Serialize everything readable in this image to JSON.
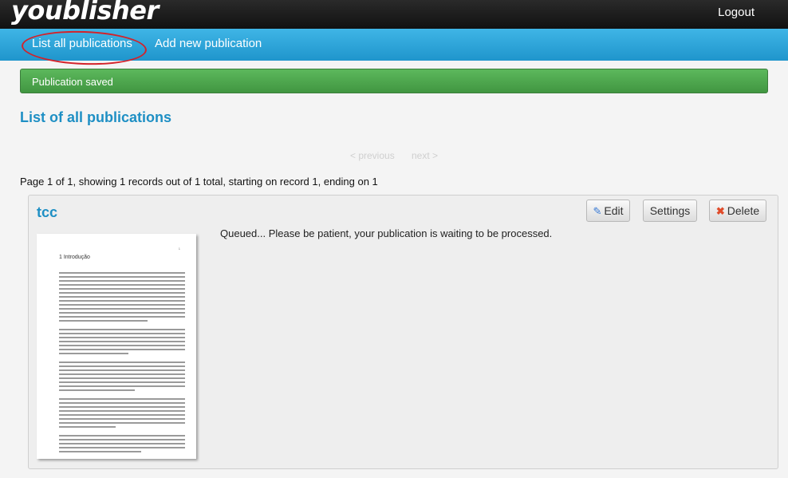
{
  "app": {
    "logo": "youblisher",
    "logout_label": "Logout"
  },
  "nav": {
    "list_all": "List all publications",
    "add_new": "Add new publication"
  },
  "alert": {
    "message": "Publication saved",
    "color": "#4cae4c"
  },
  "page": {
    "heading": "List of all publications",
    "pager": {
      "previous": "< previous",
      "next": "next >"
    },
    "records_summary": "Page 1 of 1, showing 1 records out of 1 total, starting on record 1, ending on 1"
  },
  "publication": {
    "title": "tcc",
    "status": "Queued... Please be patient, your publication is waiting to be processed.",
    "actions": {
      "edit": "Edit",
      "settings": "Settings",
      "delete": "Delete"
    },
    "thumbnail": {
      "chapter": "1  Introdução",
      "page_number": "1"
    }
  },
  "colors": {
    "accent": "#1e8fc4",
    "nav": "#2aa3d8",
    "annotation_circle": "#d3222a"
  }
}
